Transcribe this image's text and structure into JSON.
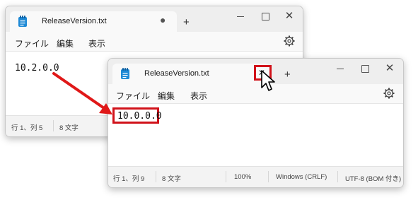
{
  "colors": {
    "highlight": "#d1121a",
    "arrow": "#e01818",
    "notepad_icon": "#1f8ad6"
  },
  "back_window": {
    "tab_title": "ReleaseVersion.txt",
    "tab_dot": "●",
    "new_tab": "+",
    "controls": {
      "close": "✕"
    },
    "menu": {
      "file": "ファイル",
      "edit": "編集",
      "view": "表示"
    },
    "content": "10.2.0.0",
    "status": {
      "position": "行 1、列 5",
      "chars": "8 文字"
    }
  },
  "front_window": {
    "tab_title": "ReleaseVersion.txt",
    "tab_close": "✕",
    "new_tab": "+",
    "controls": {
      "close": "✕"
    },
    "menu": {
      "file": "ファイル",
      "edit": "編集",
      "view": "表示"
    },
    "content": "10.0.0.0",
    "status": {
      "position": "行 1、列 9",
      "chars": "8 文字",
      "zoom": "100%",
      "line_ending": "Windows (CRLF)",
      "encoding": "UTF-8 (BOM 付き)"
    }
  },
  "icons": {
    "doc": "notepad-icon",
    "gear": "settings-gear-icon",
    "cursor": "mouse-pointer-icon",
    "arrow": "red-arrow"
  }
}
